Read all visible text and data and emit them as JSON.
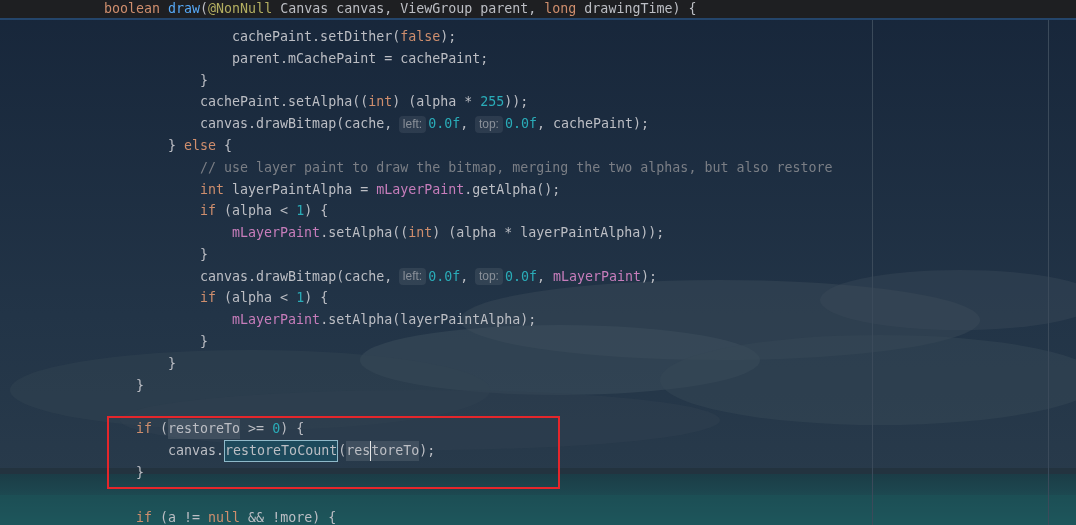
{
  "sticky_header": {
    "tokens": [
      {
        "kind": "kw",
        "text": "boolean"
      },
      {
        "kind": "decl",
        "text": "draw",
        "space_before": true
      },
      {
        "kind": "plain",
        "text": "("
      },
      {
        "kind": "ann",
        "text": "@NonNull"
      },
      {
        "kind": "plain",
        "text": "Canvas canvas, ViewGroup parent,",
        "space_before": true
      },
      {
        "kind": "kw",
        "text": "long",
        "space_before": true
      },
      {
        "kind": "plain",
        "text": "drawingTime) {",
        "space_before": true
      }
    ]
  },
  "code": [
    {
      "kind": "block",
      "children": [
        {
          "kind": "block",
          "children": [
            {
              "kind": "block",
              "children": [
                {
                  "kind": "block",
                  "children": [
                    {
                      "kind": "line",
                      "tokens": [
                        {
                          "kind": "plain",
                          "text": "cachePaint.setDither("
                        },
                        {
                          "kind": "kw",
                          "text": "false"
                        },
                        {
                          "kind": "plain",
                          "text": ");"
                        }
                      ]
                    },
                    {
                      "kind": "line",
                      "tokens": [
                        {
                          "kind": "plain",
                          "text": "parent.mCachePaint = cachePaint;"
                        }
                      ]
                    }
                  ]
                },
                {
                  "kind": "line",
                  "tokens": [
                    {
                      "kind": "plain",
                      "text": "}"
                    }
                  ]
                },
                {
                  "kind": "line",
                  "tokens": [
                    {
                      "kind": "plain",
                      "text": "cachePaint.setAlpha(("
                    },
                    {
                      "kind": "kw",
                      "text": "int"
                    },
                    {
                      "kind": "plain",
                      "text": ") (alpha * "
                    },
                    {
                      "kind": "num",
                      "text": "255"
                    },
                    {
                      "kind": "plain",
                      "text": "));"
                    }
                  ]
                },
                {
                  "kind": "line",
                  "tokens": [
                    {
                      "kind": "plain",
                      "text": "canvas.drawBitmap(cache,"
                    },
                    {
                      "kind": "hint",
                      "text": "left:"
                    },
                    {
                      "kind": "num",
                      "text": "0.0f"
                    },
                    {
                      "kind": "plain",
                      "text": ","
                    },
                    {
                      "kind": "hint",
                      "text": "top:"
                    },
                    {
                      "kind": "num",
                      "text": "0.0f"
                    },
                    {
                      "kind": "plain",
                      "text": ", cachePaint);"
                    }
                  ]
                }
              ]
            },
            {
              "kind": "line",
              "tokens": [
                {
                  "kind": "plain",
                  "text": "}"
                },
                {
                  "kind": "kw",
                  "text": "else",
                  "space_before": true
                },
                {
                  "kind": "plain",
                  "text": "{",
                  "space_before": true
                }
              ]
            },
            {
              "kind": "block",
              "children": [
                {
                  "kind": "line",
                  "tokens": [
                    {
                      "kind": "comment",
                      "text": "// use layer paint to draw the bitmap, merging the two alphas, but also restore"
                    }
                  ]
                },
                {
                  "kind": "line",
                  "tokens": [
                    {
                      "kind": "kw",
                      "text": "int"
                    },
                    {
                      "kind": "plain",
                      "text": "layerPaintAlpha = ",
                      "space_before": true
                    },
                    {
                      "kind": "field",
                      "text": "mLayerPaint"
                    },
                    {
                      "kind": "plain",
                      "text": ".getAlpha();"
                    }
                  ]
                },
                {
                  "kind": "line",
                  "tokens": [
                    {
                      "kind": "kw",
                      "text": "if"
                    },
                    {
                      "kind": "plain",
                      "text": "(alpha < ",
                      "space_before": true
                    },
                    {
                      "kind": "num",
                      "text": "1"
                    },
                    {
                      "kind": "plain",
                      "text": ") {"
                    }
                  ]
                },
                {
                  "kind": "block",
                  "children": [
                    {
                      "kind": "line",
                      "tokens": [
                        {
                          "kind": "field",
                          "text": "mLayerPaint"
                        },
                        {
                          "kind": "plain",
                          "text": ".setAlpha(("
                        },
                        {
                          "kind": "kw",
                          "text": "int"
                        },
                        {
                          "kind": "plain",
                          "text": ") (alpha * layerPaintAlpha));"
                        }
                      ]
                    }
                  ]
                },
                {
                  "kind": "line",
                  "tokens": [
                    {
                      "kind": "plain",
                      "text": "}"
                    }
                  ]
                },
                {
                  "kind": "line",
                  "tokens": [
                    {
                      "kind": "plain",
                      "text": "canvas.drawBitmap(cache,"
                    },
                    {
                      "kind": "hint",
                      "text": "left:"
                    },
                    {
                      "kind": "num",
                      "text": "0.0f"
                    },
                    {
                      "kind": "plain",
                      "text": ","
                    },
                    {
                      "kind": "hint",
                      "text": "top:"
                    },
                    {
                      "kind": "num",
                      "text": "0.0f"
                    },
                    {
                      "kind": "plain",
                      "text": ","
                    },
                    {
                      "kind": "field",
                      "text": "mLayerPaint",
                      "space_before": true
                    },
                    {
                      "kind": "plain",
                      "text": ");"
                    }
                  ]
                },
                {
                  "kind": "line",
                  "tokens": [
                    {
                      "kind": "kw",
                      "text": "if"
                    },
                    {
                      "kind": "plain",
                      "text": "(alpha < ",
                      "space_before": true
                    },
                    {
                      "kind": "num",
                      "text": "1"
                    },
                    {
                      "kind": "plain",
                      "text": ") {"
                    }
                  ]
                },
                {
                  "kind": "block",
                  "children": [
                    {
                      "kind": "line",
                      "tokens": [
                        {
                          "kind": "field",
                          "text": "mLayerPaint"
                        },
                        {
                          "kind": "plain",
                          "text": ".setAlpha(layerPaintAlpha);"
                        }
                      ]
                    }
                  ]
                },
                {
                  "kind": "line",
                  "tokens": [
                    {
                      "kind": "plain",
                      "text": "}"
                    }
                  ]
                }
              ]
            },
            {
              "kind": "line",
              "tokens": [
                {
                  "kind": "plain",
                  "text": "}"
                }
              ]
            }
          ]
        },
        {
          "kind": "line",
          "tokens": [
            {
              "kind": "plain",
              "text": "}"
            }
          ]
        },
        {
          "kind": "blank"
        },
        {
          "kind": "frame",
          "children": [
            {
              "kind": "line",
              "tokens": [
                {
                  "kind": "kw",
                  "text": "if"
                },
                {
                  "kind": "plain",
                  "text": "(",
                  "space_before": true
                },
                {
                  "kind": "usage",
                  "text": "restoreTo"
                },
                {
                  "kind": "plain",
                  "text": ">=",
                  "space_before": true
                },
                {
                  "kind": "num",
                  "text": "0",
                  "space_before": true
                },
                {
                  "kind": "plain",
                  "text": ") {"
                }
              ]
            },
            {
              "kind": "block",
              "children": [
                {
                  "kind": "line",
                  "tokens": [
                    {
                      "kind": "plain",
                      "text": "canvas."
                    },
                    {
                      "kind": "selected",
                      "text": "restoreToCount"
                    },
                    {
                      "kind": "plain",
                      "text": "("
                    },
                    {
                      "kind": "usage",
                      "text": "res"
                    },
                    {
                      "kind": "usage",
                      "text": "toreTo",
                      "caret": true
                    },
                    {
                      "kind": "plain",
                      "text": ");"
                    }
                  ]
                }
              ]
            },
            {
              "kind": "line",
              "tokens": [
                {
                  "kind": "plain",
                  "text": "}"
                }
              ]
            }
          ]
        },
        {
          "kind": "blank"
        },
        {
          "kind": "line",
          "tokens": [
            {
              "kind": "kw",
              "text": "if"
            },
            {
              "kind": "plain",
              "text": "(a != ",
              "space_before": true
            },
            {
              "kind": "kw",
              "text": "null"
            },
            {
              "kind": "plain",
              "text": "&& !more) {",
              "space_before": true
            }
          ]
        }
      ]
    }
  ]
}
